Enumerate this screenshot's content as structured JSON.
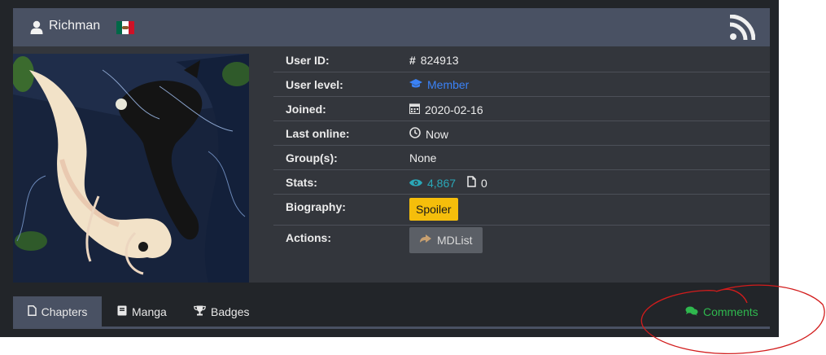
{
  "profile": {
    "username": "Richman",
    "flag_colors": [
      "#006847",
      "#ffffff",
      "#ce1126"
    ]
  },
  "info": {
    "rows": [
      {
        "label": "User ID:",
        "icon": "hash-icon",
        "value": "824913"
      },
      {
        "label": "User level:",
        "icon": "graduation-cap-icon",
        "value": "Member"
      },
      {
        "label": "Joined:",
        "icon": "calendar-icon",
        "value": "2020-02-16"
      },
      {
        "label": "Last online:",
        "icon": "clock-icon",
        "value": "Now"
      },
      {
        "label": "Group(s):",
        "value": "None"
      },
      {
        "label": "Stats:",
        "views": "4,867",
        "chapters": "0"
      },
      {
        "label": "Biography:",
        "button": "Spoiler"
      },
      {
        "label": "Actions:",
        "button": "MDList"
      }
    ]
  },
  "tabs": {
    "chapters": "Chapters",
    "manga": "Manga",
    "badges": "Badges",
    "comments": "Comments"
  },
  "colors": {
    "header": "#495163",
    "panel": "#222529",
    "link_blue": "#3b82f6",
    "teal": "#2aa8b8",
    "spoiler": "#f5be0b",
    "comments_green": "#2fb84e",
    "annotation_red": "#d21c1c"
  }
}
